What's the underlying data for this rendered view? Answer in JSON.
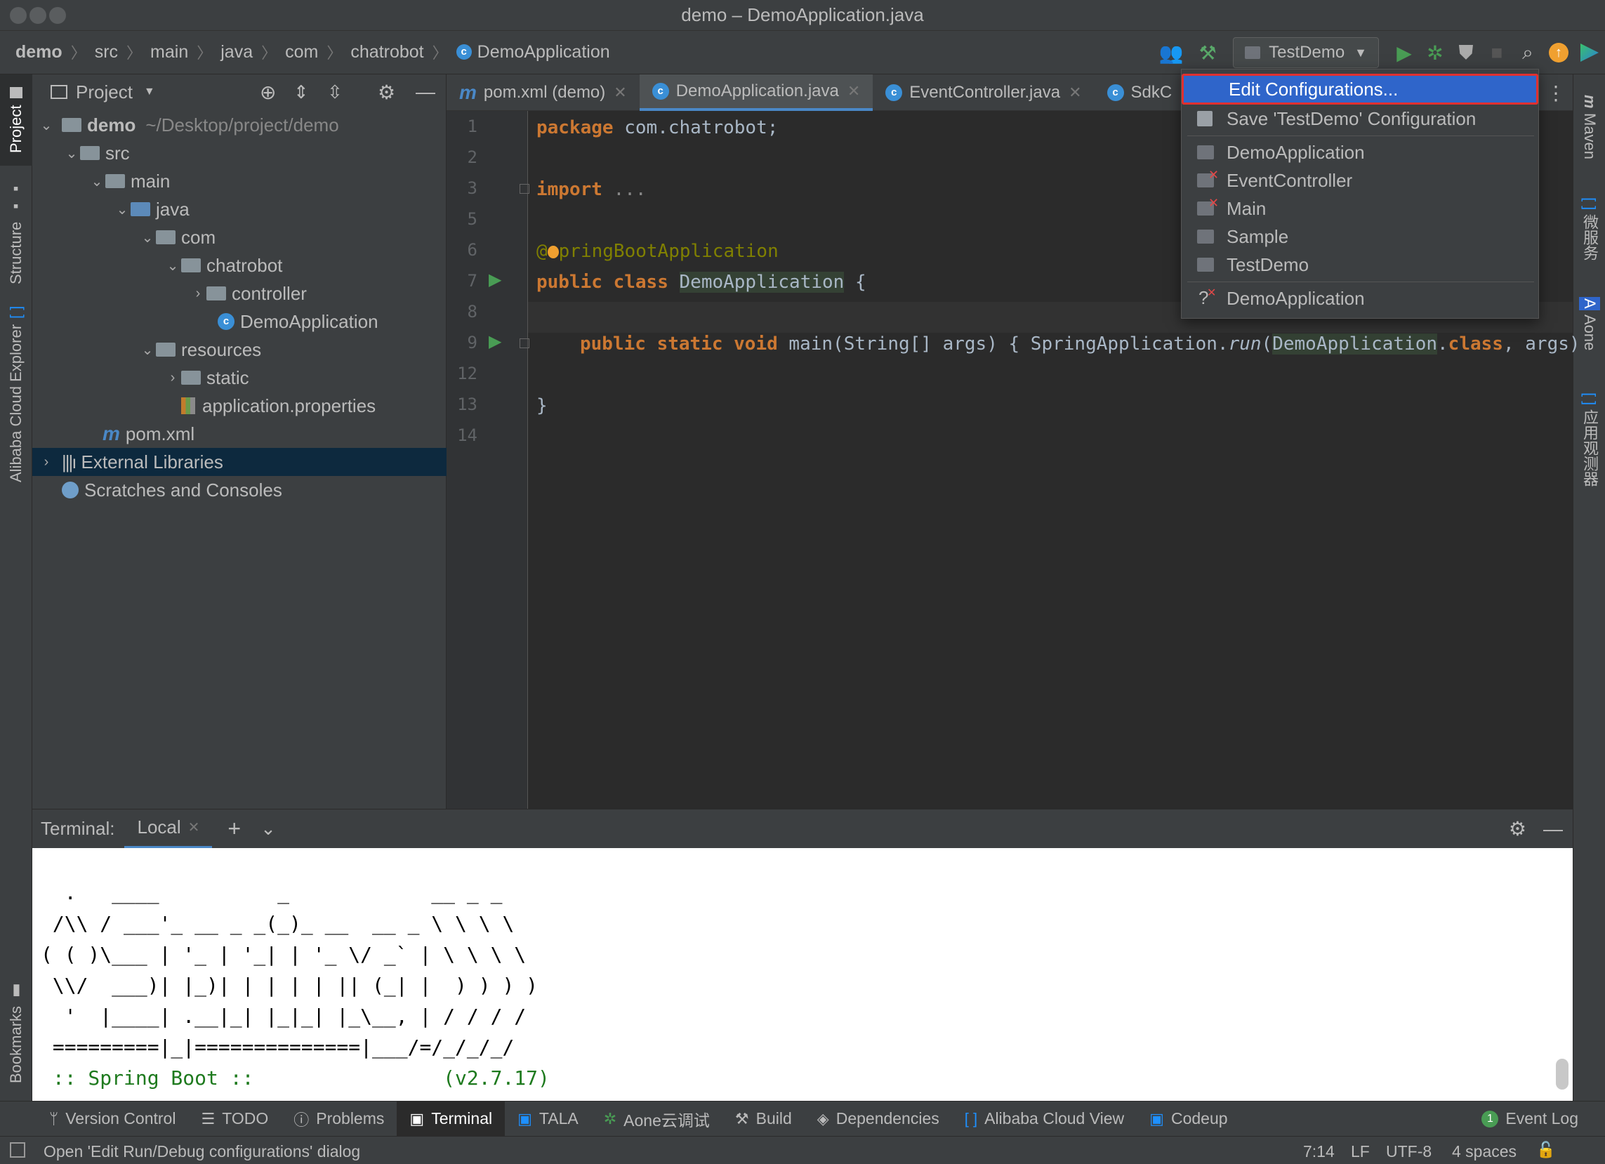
{
  "window": {
    "title": "demo – DemoApplication.java"
  },
  "breadcrumbs": [
    "demo",
    "src",
    "main",
    "java",
    "com",
    "chatrobot",
    "DemoApplication"
  ],
  "toolbar": {
    "run_config": "TestDemo"
  },
  "left_strip": {
    "project": "Project",
    "structure": "Structure",
    "cloud_explorer": "Alibaba Cloud Explorer",
    "bookmarks": "Bookmarks"
  },
  "right_strip": {
    "maven": "Maven",
    "micro": "微服务",
    "aone": "Aone",
    "observer": "应用观测器"
  },
  "project": {
    "header": "Project",
    "tree": [
      {
        "label": "demo",
        "extra": "~/Desktop/project/demo",
        "bold": true
      },
      {
        "label": "src"
      },
      {
        "label": "main"
      },
      {
        "label": "java"
      },
      {
        "label": "com"
      },
      {
        "label": "chatrobot"
      },
      {
        "label": "controller"
      },
      {
        "label": "DemoApplication"
      },
      {
        "label": "resources"
      },
      {
        "label": "static"
      },
      {
        "label": "application.properties"
      },
      {
        "label": "pom.xml"
      },
      {
        "label": "External Libraries"
      },
      {
        "label": "Scratches and Consoles"
      }
    ]
  },
  "tabs": [
    {
      "label": "pom.xml (demo)"
    },
    {
      "label": "DemoApplication.java"
    },
    {
      "label": "EventController.java"
    },
    {
      "label": "SdkC"
    }
  ],
  "code": {
    "line_numbers": [
      "1",
      "2",
      "3",
      "5",
      "6",
      "7",
      "8",
      "9",
      "12",
      "13",
      "14"
    ],
    "l1_kw": "package",
    "l1_rest": " com.chatrobot;",
    "l3_kw": "import",
    "l3_rest": " ...",
    "l6_ann_a": "@",
    "l6_ann_b": "pringBootApplication",
    "l7_kw1": "public",
    "l7_kw2": "class",
    "l7_name": "DemoApplication",
    "l7_rest": " {",
    "l9_kw1": "public",
    "l9_kw2": "static",
    "l9_kw3": "void",
    "l9_a": " main(String[] args) { SpringApplication.",
    "l9_run": "run",
    "l9_b": "(",
    "l9_cls": "DemoApplication",
    "l9_c": ".",
    "l9_kw4": "class",
    "l9_d": ", args)",
    "l13": "}"
  },
  "popup": {
    "items": [
      {
        "label": "Edit Configurations..."
      },
      {
        "label": "Save 'TestDemo' Configuration"
      },
      {
        "label": "DemoApplication"
      },
      {
        "label": "EventController"
      },
      {
        "label": "Main"
      },
      {
        "label": "Sample"
      },
      {
        "label": "TestDemo"
      },
      {
        "label": "DemoApplication"
      }
    ]
  },
  "terminal": {
    "title": "Terminal:",
    "tab": "Local",
    "lines": [
      "  .   ____          _            __ _ _",
      " /\\\\ / ___'_ __ _ _(_)_ __  __ _ \\ \\ \\ \\",
      "( ( )\\___ | '_ | '_| | '_ \\/ _` | \\ \\ \\ \\",
      " \\\\/  ___)| |_)| | | | | || (_| |  ) ) ) )",
      "  '  |____| .__|_| |_|_| |_\\__, | / / / /",
      " =========|_|==============|___/=/_/_/_/",
      " :: Spring Boot ::                (v2.7.17)"
    ]
  },
  "bottom_tools": [
    {
      "label": "Version Control",
      "icon": "branch-icon"
    },
    {
      "label": "TODO",
      "icon": "list-icon"
    },
    {
      "label": "Problems",
      "icon": "info-icon"
    },
    {
      "label": "Terminal",
      "icon": "terminal-icon"
    },
    {
      "label": "TALA",
      "icon": "tala-icon"
    },
    {
      "label": "Aone云调试",
      "icon": "bug-icon"
    },
    {
      "label": "Build",
      "icon": "hammer-icon"
    },
    {
      "label": "Dependencies",
      "icon": "layers-icon"
    },
    {
      "label": "Alibaba Cloud View",
      "icon": "cloud-icon"
    },
    {
      "label": "Codeup",
      "icon": "codeup-icon"
    }
  ],
  "event_log": {
    "count": "1",
    "label": "Event Log"
  },
  "status": {
    "message": "Open 'Edit Run/Debug configurations' dialog",
    "position": "7:14",
    "line_sep": "LF",
    "encoding": "UTF-8",
    "indent": "4 spaces"
  }
}
